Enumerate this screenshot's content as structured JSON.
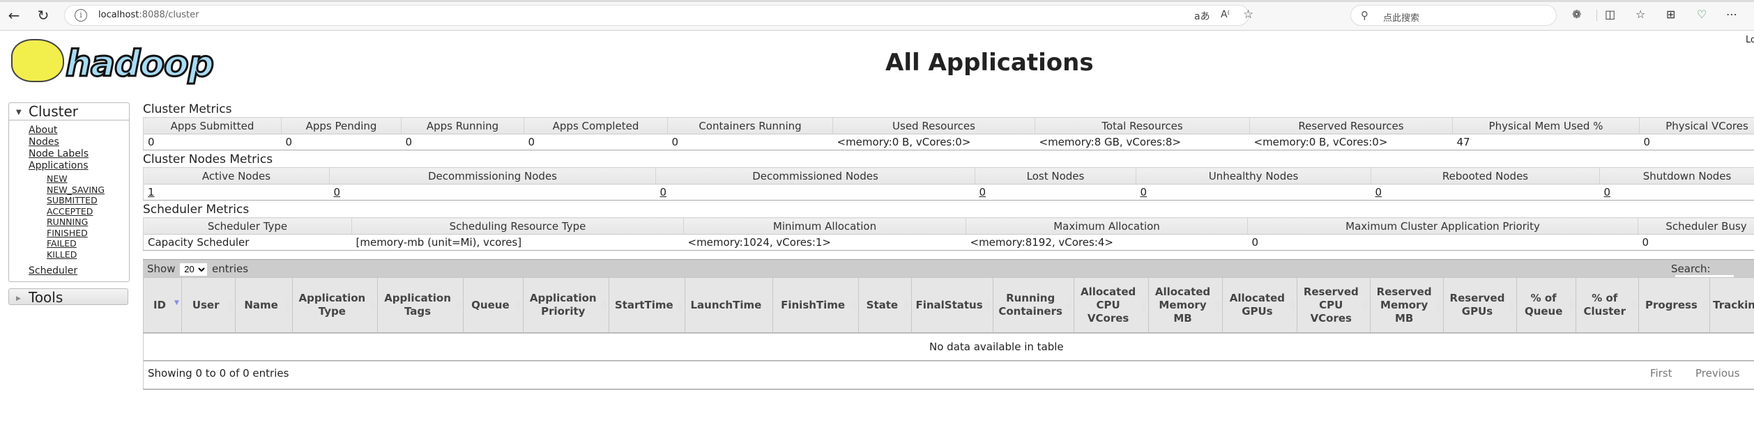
{
  "browser": {
    "url_host": "localhost",
    "url_rest": ":8088/cluster",
    "search_placeholder": "点此搜索",
    "icons": [
      "back-icon",
      "refresh-icon",
      "info-icon",
      "translate-icon",
      "read-aloud-icon",
      "favorite-star-icon",
      "search-icon",
      "extensions-icon",
      "split-screen-icon",
      "favorites-icon",
      "collections-icon",
      "browser-essentials-icon",
      "more-icon"
    ]
  },
  "header": {
    "logo_text": "hadoop",
    "title": "All Applications",
    "login_text": "Lo"
  },
  "sidebar": {
    "cluster_label": "Cluster",
    "items": [
      "About",
      "Nodes",
      "Node Labels",
      "Applications"
    ],
    "app_states": [
      "NEW",
      "NEW_SAVING",
      "SUBMITTED",
      "ACCEPTED",
      "RUNNING",
      "FINISHED",
      "FAILED",
      "KILLED"
    ],
    "scheduler": "Scheduler",
    "tools_label": "Tools"
  },
  "cluster_metrics": {
    "title": "Cluster Metrics",
    "headers": [
      "Apps Submitted",
      "Apps Pending",
      "Apps Running",
      "Apps Completed",
      "Containers Running",
      "Used Resources",
      "Total Resources",
      "Reserved Resources",
      "Physical Mem Used %",
      "Physical VCores"
    ],
    "values": [
      "0",
      "0",
      "0",
      "0",
      "0",
      "<memory:0 B, vCores:0>",
      "<memory:8 GB, vCores:8>",
      "<memory:0 B, vCores:0>",
      "47",
      "0"
    ]
  },
  "node_metrics": {
    "title": "Cluster Nodes Metrics",
    "headers": [
      "Active Nodes",
      "Decommissioning Nodes",
      "Decommissioned Nodes",
      "Lost Nodes",
      "Unhealthy Nodes",
      "Rebooted Nodes",
      "Shutdown Nodes"
    ],
    "values": [
      "1",
      "0",
      "0",
      "0",
      "0",
      "0",
      "0"
    ]
  },
  "scheduler_metrics": {
    "title": "Scheduler Metrics",
    "headers": [
      "Scheduler Type",
      "Scheduling Resource Type",
      "Minimum Allocation",
      "Maximum Allocation",
      "Maximum Cluster Application Priority",
      "Scheduler Busy"
    ],
    "values": [
      "Capacity Scheduler",
      "[memory-mb (unit=Mi), vcores]",
      "<memory:1024, vCores:1>",
      "<memory:8192, vCores:4>",
      "0",
      "0"
    ]
  },
  "apps_table": {
    "show_label": "Show",
    "entries_label": "entries",
    "page_size": "20",
    "search_label": "Search:",
    "search_value": "",
    "columns": [
      "ID",
      "User",
      "Name",
      "Application Type",
      "Application Tags",
      "Queue",
      "Application Priority",
      "StartTime",
      "LaunchTime",
      "FinishTime",
      "State",
      "FinalStatus",
      "Running Containers",
      "Allocated CPU VCores",
      "Allocated Memory MB",
      "Allocated GPUs",
      "Reserved CPU VCores",
      "Reserved Memory MB",
      "Reserved GPUs",
      "% of Queue",
      "% of Cluster",
      "Progress",
      "Tracking UI"
    ],
    "empty_message": "No data available in table",
    "info": "Showing 0 to 0 of 0 entries",
    "first": "First",
    "previous": "Previous"
  }
}
